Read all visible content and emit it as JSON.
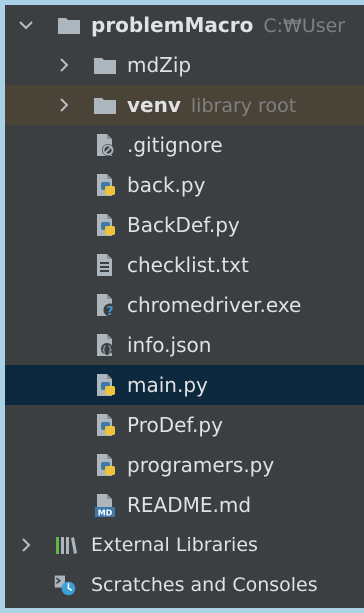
{
  "project": {
    "name": "problemMacro",
    "path_hint": "C:₩User"
  },
  "items": [
    {
      "name": "mdZip",
      "kind": "folder"
    },
    {
      "name": "venv",
      "kind": "folder",
      "hint": "library root"
    },
    {
      "name": ".gitignore",
      "kind": "gitignore"
    },
    {
      "name": "back.py",
      "kind": "python"
    },
    {
      "name": "BackDef.py",
      "kind": "python"
    },
    {
      "name": "checklist.txt",
      "kind": "text"
    },
    {
      "name": "chromedriver.exe",
      "kind": "unknown"
    },
    {
      "name": "info.json",
      "kind": "json"
    },
    {
      "name": "main.py",
      "kind": "python"
    },
    {
      "name": "ProDef.py",
      "kind": "python"
    },
    {
      "name": "programers.py",
      "kind": "python"
    },
    {
      "name": "README.md",
      "kind": "markdown",
      "icon_text": "MD"
    }
  ],
  "external_libraries": {
    "label": "External Libraries"
  },
  "scratches": {
    "label": "Scratches and Consoles"
  },
  "colors": {
    "background": "#3c3f41",
    "selected_row": "#0d293e",
    "excluded_row": "#4a4337",
    "text": "#dfe1e5",
    "hint": "#808080",
    "folder": "#adb5bd",
    "python_blue": "#3c78aa",
    "python_yellow": "#f0c33c"
  }
}
